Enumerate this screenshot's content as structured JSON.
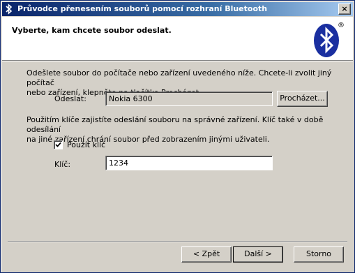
{
  "window": {
    "title": "Průvodce přenesením souborů pomocí rozhraní Bluetooth",
    "close_glyph": "×"
  },
  "header": {
    "title": "Vyberte, kam chcete soubor odeslat.",
    "logo": "bluetooth-logo",
    "registered_mark": "®",
    "logo_color": "#1a2fa0"
  },
  "body": {
    "intro_line1": "Odešlete soubor do počítače nebo zařízení uvedeného níže. Chcete-li zvolit jiný počítač",
    "intro_line2": "nebo zařízení, klepněte na tlačítko Procházet.",
    "send_label": "Odeslat:",
    "send_value": "Nokia 6300",
    "browse_label": "Procházet...",
    "key_info_line1": "Použitím klíče zajistíte odeslání souboru na správné zařízení. Klíč také v době odesílání",
    "key_info_line2": "na jiné zařízení chrání soubor před zobrazením jinými uživateli.",
    "use_key_label": "Použít klíč",
    "use_key_checked": true,
    "key_label": "Klíč:",
    "key_value": "1234"
  },
  "footer": {
    "back_label": "< Zpět",
    "next_label": "Další >",
    "cancel_label": "Storno"
  }
}
